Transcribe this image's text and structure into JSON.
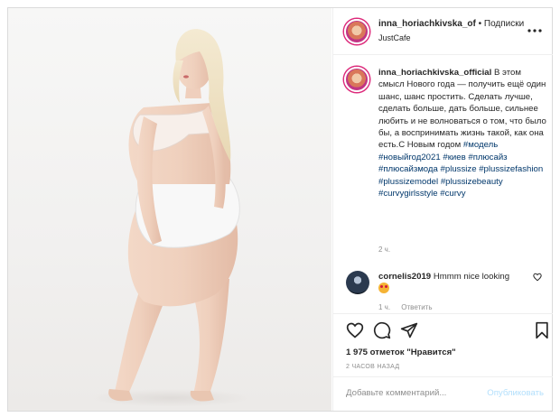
{
  "header": {
    "username": "inna_horiachkivska_of",
    "separator": "•",
    "follow_label": "Подписки",
    "location": "JustCafe"
  },
  "caption": {
    "username": "inna_horiachkivska_official",
    "text": " В этом смысл Нового года — получить ещё один шанс, шанс простить. Сделать лучше, сделать больше, дать больше, сильнее любить и не волноваться о том, что было бы, а воспринимать жизнь такой, как она есть.С Новым годом ",
    "hashtags": [
      "#модель",
      "#новыйгод2021",
      "#киев",
      "#плюсайз",
      "#плюсайзмода",
      "#plussize",
      "#plussizefashion",
      "#plussizemodel",
      "#plussizebeauty",
      "#curvygirlsstyle",
      "#curvy"
    ],
    "time": "2 ч."
  },
  "comment": {
    "username": "cornelis2019",
    "text": "Hmmm nice looking",
    "time": "1 ч.",
    "reply_label": "Ответить"
  },
  "likes": "1 975 отметок \"Нравится\"",
  "posted_ago": "2 ЧАСОВ НАЗАД",
  "add_comment": {
    "placeholder": "Добавьте комментарий...",
    "post_label": "Опубликовать"
  },
  "colors": {
    "hashtag": "#00376b",
    "post_disabled": "#b2dffc",
    "meta": "#8e8e8e"
  },
  "icons": [
    "more-icon",
    "heart-icon",
    "comment-icon",
    "share-icon",
    "bookmark-icon",
    "small-heart-icon"
  ]
}
